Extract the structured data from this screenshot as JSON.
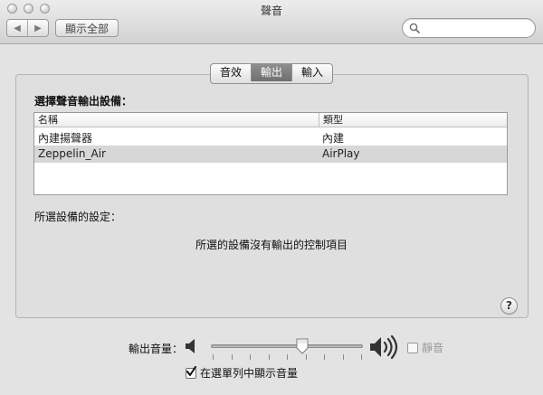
{
  "window": {
    "title": "聲音"
  },
  "toolbar": {
    "back_glyph": "◀",
    "forward_glyph": "▶",
    "show_all_label": "顯示全部",
    "search": {
      "value": "",
      "placeholder": ""
    }
  },
  "tabs": [
    {
      "label": "音效",
      "active": false
    },
    {
      "label": "輸出",
      "active": true
    },
    {
      "label": "輸入",
      "active": false
    }
  ],
  "output": {
    "section_label": "選擇聲音輸出設備：",
    "columns": [
      "名稱",
      "類型"
    ],
    "devices": [
      {
        "name": "內建揚聲器",
        "type": "內建",
        "selected": false
      },
      {
        "name": "Zeppelin_Air",
        "type": "AirPlay",
        "selected": true
      }
    ],
    "settings_label": "所選設備的設定：",
    "no_controls_message": "所選的設備沒有輸出的控制項目"
  },
  "help": {
    "glyph": "?"
  },
  "volume": {
    "label": "輸出音量：",
    "level": 0.6,
    "mute_label": "靜音",
    "mute_checked": false,
    "show_in_menu_label": "在選單列中顯示音量",
    "show_in_menu_checked": true
  },
  "icons": {
    "close": "traffic-light-close-icon",
    "minimize": "traffic-light-minimize-icon",
    "zoom": "traffic-light-zoom-icon",
    "search": "search-icon",
    "speaker_low": "speaker-low-icon",
    "speaker_high": "speaker-high-icon"
  }
}
